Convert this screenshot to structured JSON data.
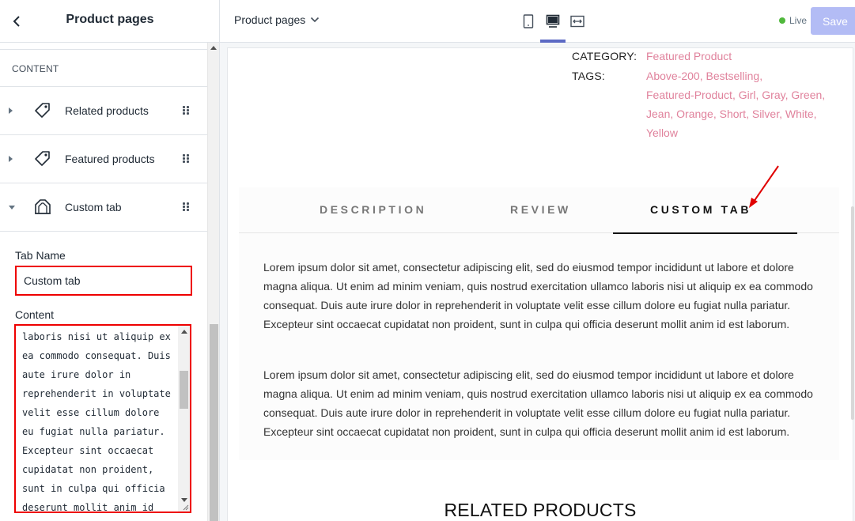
{
  "sidebar": {
    "title": "Product pages",
    "section_title": "CONTENT",
    "blocks": [
      {
        "label": "Related products",
        "icon": "tag-icon",
        "expanded": false
      },
      {
        "label": "Featured products",
        "icon": "tag-icon",
        "expanded": false
      },
      {
        "label": "Custom tab",
        "icon": "tab-icon",
        "expanded": true
      }
    ],
    "tab_name_label": "Tab Name",
    "tab_name_value": "Custom tab",
    "content_label": "Content",
    "content_value": "laboris nisi ut aliquip ex\nea commodo consequat. Duis\naute irure dolor in\nreprehenderit in voluptate\nvelit esse cillum dolore\neu fugiat nulla pariatur.\nExcepteur sint occaecat\ncupidatat non proident,\nsunt in culpa qui officia\ndeserunt mollit anim id"
  },
  "topbar": {
    "page_select": "Product pages",
    "live_label": "Live",
    "save_label": "Save",
    "active_device": "desktop"
  },
  "preview": {
    "category_label": "CATEGORY:",
    "category_value": "Featured Product",
    "tags_label": "TAGS:",
    "tags": [
      "Above-200",
      "Bestselling",
      "Featured-Product",
      "Girl",
      "Gray",
      "Green",
      "Jean",
      "Orange",
      "Short",
      "Silver",
      "White",
      "Yellow"
    ],
    "tags_lines": [
      "Above-200, Bestselling,",
      "Featured-Product, Girl, Gray, Green,",
      "Jean, Orange, Short, Silver, White,",
      "Yellow"
    ],
    "tabs": [
      {
        "label": "DESCRIPTION",
        "active": false
      },
      {
        "label": "REVIEW",
        "active": false
      },
      {
        "label": "CUSTOM TAB",
        "active": true
      }
    ],
    "paragraph_1": "Lorem ipsum dolor sit amet, consectetur adipiscing elit, sed do eiusmod tempor incididunt ut labore et dolore magna aliqua. Ut enim ad minim veniam, quis nostrud exercitation ullamco laboris nisi ut aliquip ex ea commodo consequat. Duis aute irure dolor in reprehenderit in voluptate velit esse cillum dolore eu fugiat nulla pariatur. Excepteur sint occaecat cupidatat non proident, sunt in culpa qui officia deserunt mollit anim id est laborum.",
    "paragraph_2": "Lorem ipsum dolor sit amet, consectetur adipiscing elit, sed do eiusmod tempor incididunt ut labore et dolore magna aliqua. Ut enim ad minim veniam, quis nostrud exercitation ullamco laboris nisi ut aliquip ex ea commodo consequat. Duis aute irure dolor in reprehenderit in voluptate velit esse cillum dolore eu fugiat nulla pariatur. Excepteur sint occaecat cupidatat non proident, sunt in culpa qui officia deserunt mollit anim id est laborum.",
    "related_title": "RELATED PRODUCTS"
  },
  "colors": {
    "accent": "#5c6ac4",
    "live": "#50b83c",
    "tag_link": "#e0829c",
    "annotation": "#e00000"
  }
}
